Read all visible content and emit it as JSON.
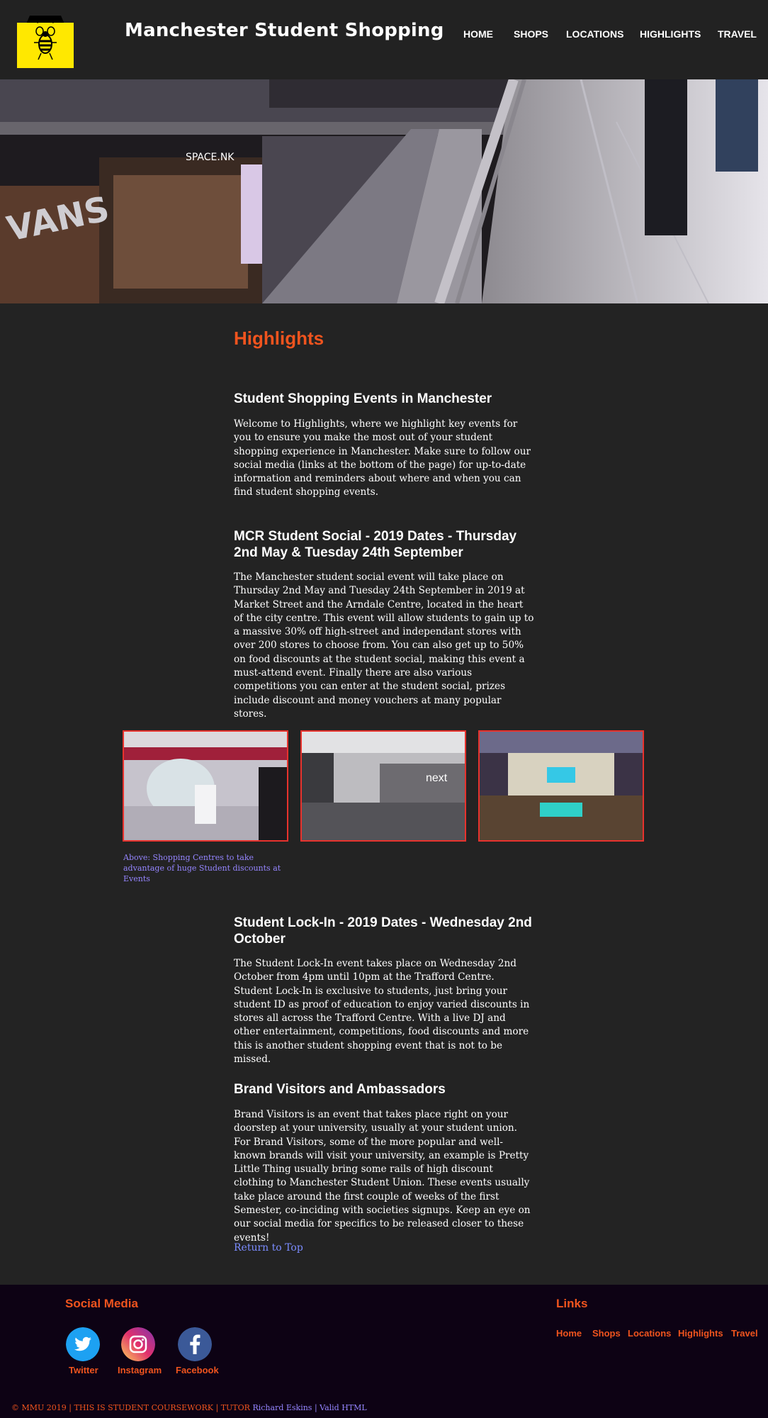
{
  "header": {
    "site_title": "Manchester Student Shopping",
    "nav": [
      "HOME",
      "SHOPS",
      "LOCATIONS",
      "HIGHLIGHTS",
      "TRAVEL"
    ]
  },
  "page_title": "Highlights",
  "sections": [
    {
      "heading": "Student Shopping Events in Manchester",
      "text": "Welcome to Highlights, where we highlight key events for you to ensure you make the most out of your student shopping experience in Manchester. Make sure to follow our social media (links at the bottom of the page) for up-to-date information and reminders about where and when you can find student shopping events."
    },
    {
      "heading": "MCR Student Social - 2019 Dates - Thursday 2nd May & Tuesday 24th September",
      "text": "The Manchester student social event will take place on Thursday 2nd May and Tuesday 24th September in 2019 at Market Street and the Arndale Centre, located in the heart of the city centre. This event will allow students to gain up to a massive 30% off high-street and independant stores with over 200 stores to choose from. You can also get up to 50% on food discounts at the student social, making this event a must-attend event. Finally there are also various competitions you can enter at the student social, prizes include discount and money vouchers at many popular stores."
    },
    {
      "heading": "Student Lock-In - 2019 Dates - Wednesday 2nd October",
      "text": "The Student Lock-In event takes place on Wednesday 2nd October from 4pm until 10pm at the Trafford Centre. Student Lock-In is exclusive to students, just bring your student ID as proof of education to enjoy varied discounts in stores all across the Trafford Centre. With a live DJ and other entertainment, competitions, food discounts and more this is another student shopping event that is not to be missed."
    },
    {
      "heading": "Brand Visitors and Ambassadors",
      "text": "Brand Visitors is an event that takes place right on your doorstep at your university, usually at your student union. For Brand Visitors, some of the more popular and well-known brands will visit your university, an example is Pretty Little Thing usually bring some rails of high discount clothing to Manchester Student Union. These events usually take place around the first couple of weeks of the first Semester, co-inciding with societies signups. Keep an eye on our social media for specifics to be released closer to these events!"
    }
  ],
  "gallery": {
    "caption": "Above: Shopping Centres to take advantage of huge Student discounts at Events",
    "image_texts": [
      "next"
    ]
  },
  "hero_texts": [
    "VANS",
    "SPACE.NK"
  ],
  "return_label": "Return to Top",
  "footer": {
    "social_heading": "Social Media",
    "social": [
      "Twitter",
      "Instagram",
      "Facebook"
    ],
    "links_heading": "Links",
    "links": [
      "Home",
      "Shops",
      "Locations",
      "Highlights",
      "Travel"
    ],
    "copy_1": "© MMU 2019 | THIS IS STUDENT COURSEWORK | TUTOR",
    "copy_2": "Richard Eskins | Valid HTML"
  }
}
